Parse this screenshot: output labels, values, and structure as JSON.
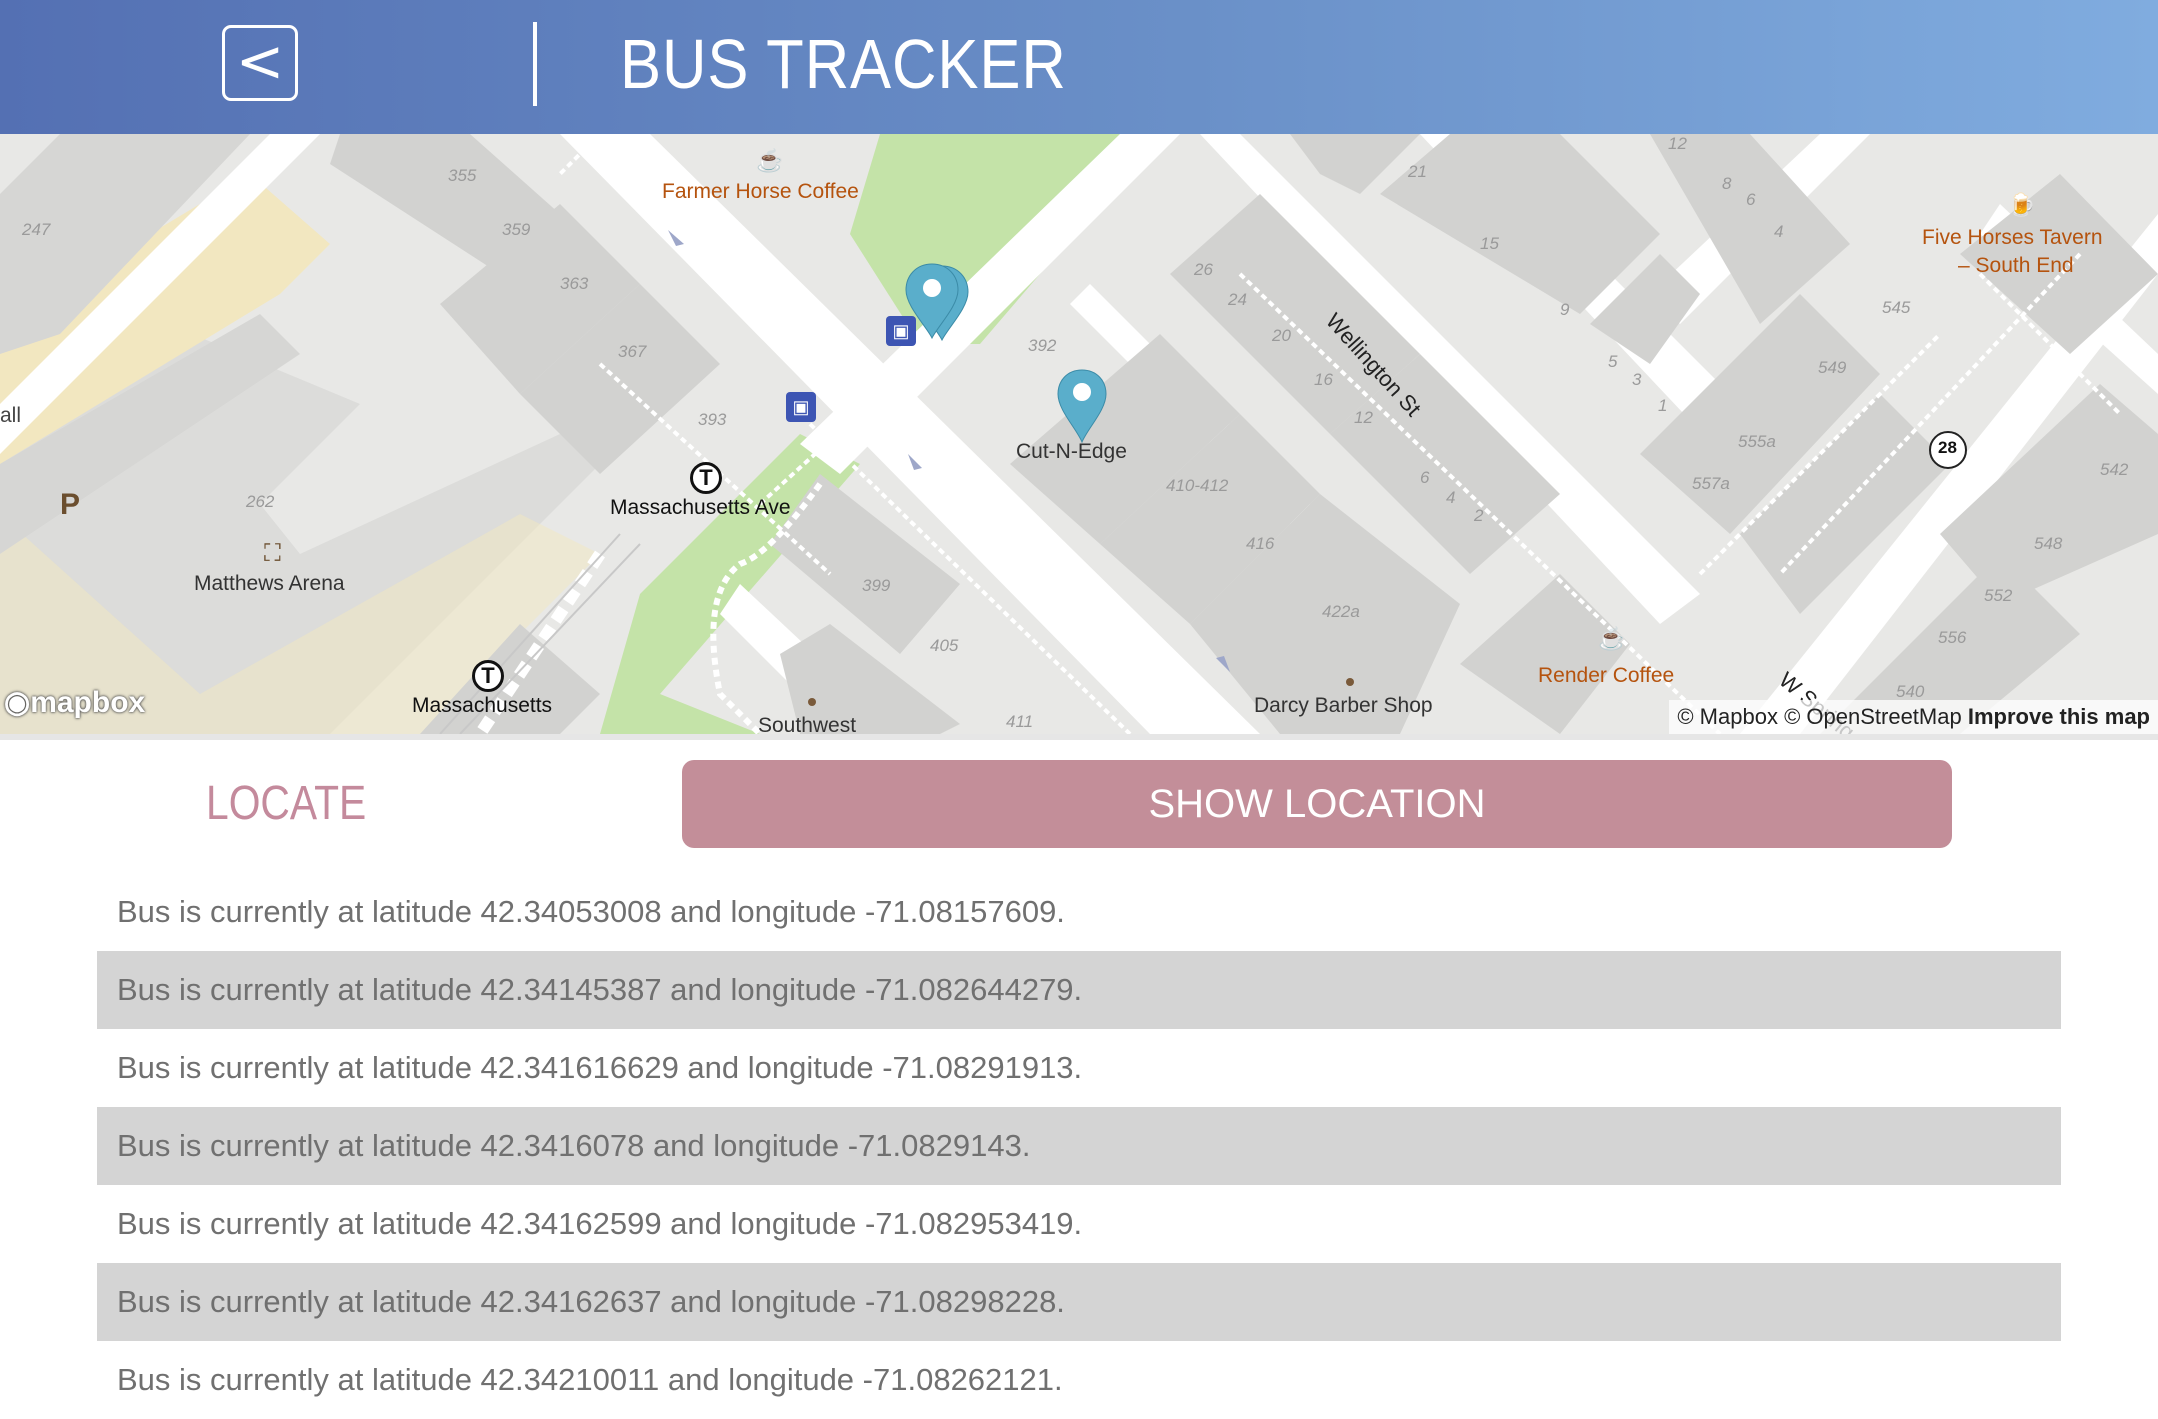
{
  "header": {
    "back_label": "<",
    "title": "BUS TRACKER"
  },
  "map": {
    "poi_labels": {
      "farmer_horse_coffee": "Farmer Horse Coffee",
      "five_horses_tavern": "Five Horses Tavern",
      "five_horses_tavern_2": "– South End",
      "cut_n_edge": "Cut-N-Edge",
      "massachusetts_ave_station": "Massachusetts Ave",
      "matthews_arena": "Matthews Arena",
      "massachusetts": "Massachusetts",
      "southwest": "Southwest",
      "darcy_barber_shop": "Darcy Barber Shop",
      "render_coffee": "Render Coffee",
      "wellington_st": "Wellington St",
      "w_springfield": "W Spring",
      "hall": "all",
      "parking": "P",
      "route_28": "28"
    },
    "house_numbers": {
      "n355": "355",
      "n359": "359",
      "n363": "363",
      "n367": "367",
      "n247": "247",
      "n393": "393",
      "n262": "262",
      "n399": "399",
      "n405": "405",
      "n411": "411",
      "n392": "392",
      "n410": "410-412",
      "n416": "416",
      "n422a": "422a",
      "n26": "26",
      "n24": "24",
      "n20": "20",
      "n16": "16",
      "n12": "12",
      "n6": "6",
      "n4": "4",
      "n2": "2",
      "n21": "21",
      "n15": "15",
      "n9": "9",
      "n5": "5",
      "n3": "3",
      "n1": "1",
      "n8": "8",
      "n6b": "6",
      "n4b": "4",
      "n12b": "12",
      "n545": "545",
      "n549": "549",
      "n555a": "555a",
      "n557a": "557a",
      "n542": "542",
      "n548": "548",
      "n552": "552",
      "n556": "556",
      "n540": "540"
    },
    "attribution": {
      "mapbox": "© Mapbox",
      "osm": "© OpenStreetMap",
      "improve": "Improve this map"
    },
    "logo": "mapbox"
  },
  "controls": {
    "locate_label": "LOCATE",
    "show_location_label": "SHOW LOCATION"
  },
  "log_entries": [
    "Bus is currently at latitude 42.34053008 and longitude -71.08157609.",
    "Bus is currently at latitude 42.34145387 and longitude -71.082644279.",
    "Bus is currently at latitude 42.341616629 and longitude -71.08291913.",
    "Bus is currently at latitude 42.3416078 and longitude -71.0829143.",
    "Bus is currently at latitude 42.34162599 and longitude -71.082953419.",
    "Bus is currently at latitude 42.34162637 and longitude -71.08298228.",
    "Bus is currently at latitude 42.34210011 and longitude -71.08262121."
  ],
  "colors": {
    "header_start": "#5470b3",
    "header_end": "#80acdf",
    "accent_pink": "#c38e99",
    "locate_text": "#c48a9c",
    "marker_blue": "#5aaecb",
    "park_green": "#c4e3a8"
  }
}
